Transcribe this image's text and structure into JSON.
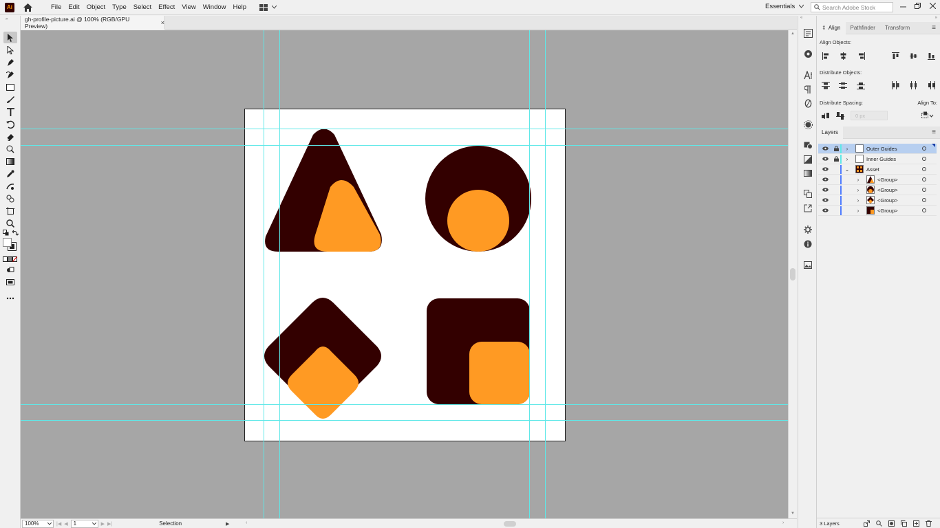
{
  "app": {
    "logo_text": "Ai"
  },
  "menu": {
    "items": [
      "File",
      "Edit",
      "Object",
      "Type",
      "Select",
      "Effect",
      "View",
      "Window",
      "Help"
    ],
    "workspace": "Essentials",
    "search_placeholder": "Search Adobe Stock"
  },
  "document": {
    "tab_title": "gh-profile-picture.ai @ 100% (RGB/GPU Preview)",
    "close_glyph": "×"
  },
  "colors": {
    "dark_shape": "#330000",
    "orange_shape": "#ff9a23",
    "guide": "#5fe8e8",
    "canvas_bg": "#a6a6a6",
    "selected_row": "#b7cff0"
  },
  "status": {
    "zoom": "100%",
    "page": "1",
    "tool": "Selection"
  },
  "align_panel": {
    "tabs": [
      "Align",
      "Pathfinder",
      "Transform"
    ],
    "active_tab_marker": "⇕",
    "align_objects_label": "Align Objects:",
    "distribute_objects_label": "Distribute Objects:",
    "distribute_spacing_label": "Distribute Spacing:",
    "align_to_label": "Align To:",
    "spacing_value": "0 px"
  },
  "layers_panel": {
    "tab": "Layers",
    "rows": [
      {
        "name": "Outer Guides",
        "selected": true,
        "color": "#5fe8e8"
      },
      {
        "name": "Inner Guides",
        "selected": false,
        "color": "#5fe8e8"
      },
      {
        "name": "Asset",
        "selected": false,
        "color": "#4f7cff"
      },
      {
        "name": "<Group>",
        "selected": false,
        "color": "#4f7cff"
      },
      {
        "name": "<Group>",
        "selected": false,
        "color": "#4f7cff"
      },
      {
        "name": "<Group>",
        "selected": false,
        "color": "#4f7cff"
      },
      {
        "name": "<Group>",
        "selected": false,
        "color": "#4f7cff"
      }
    ],
    "footer_count": "3 Layers"
  }
}
